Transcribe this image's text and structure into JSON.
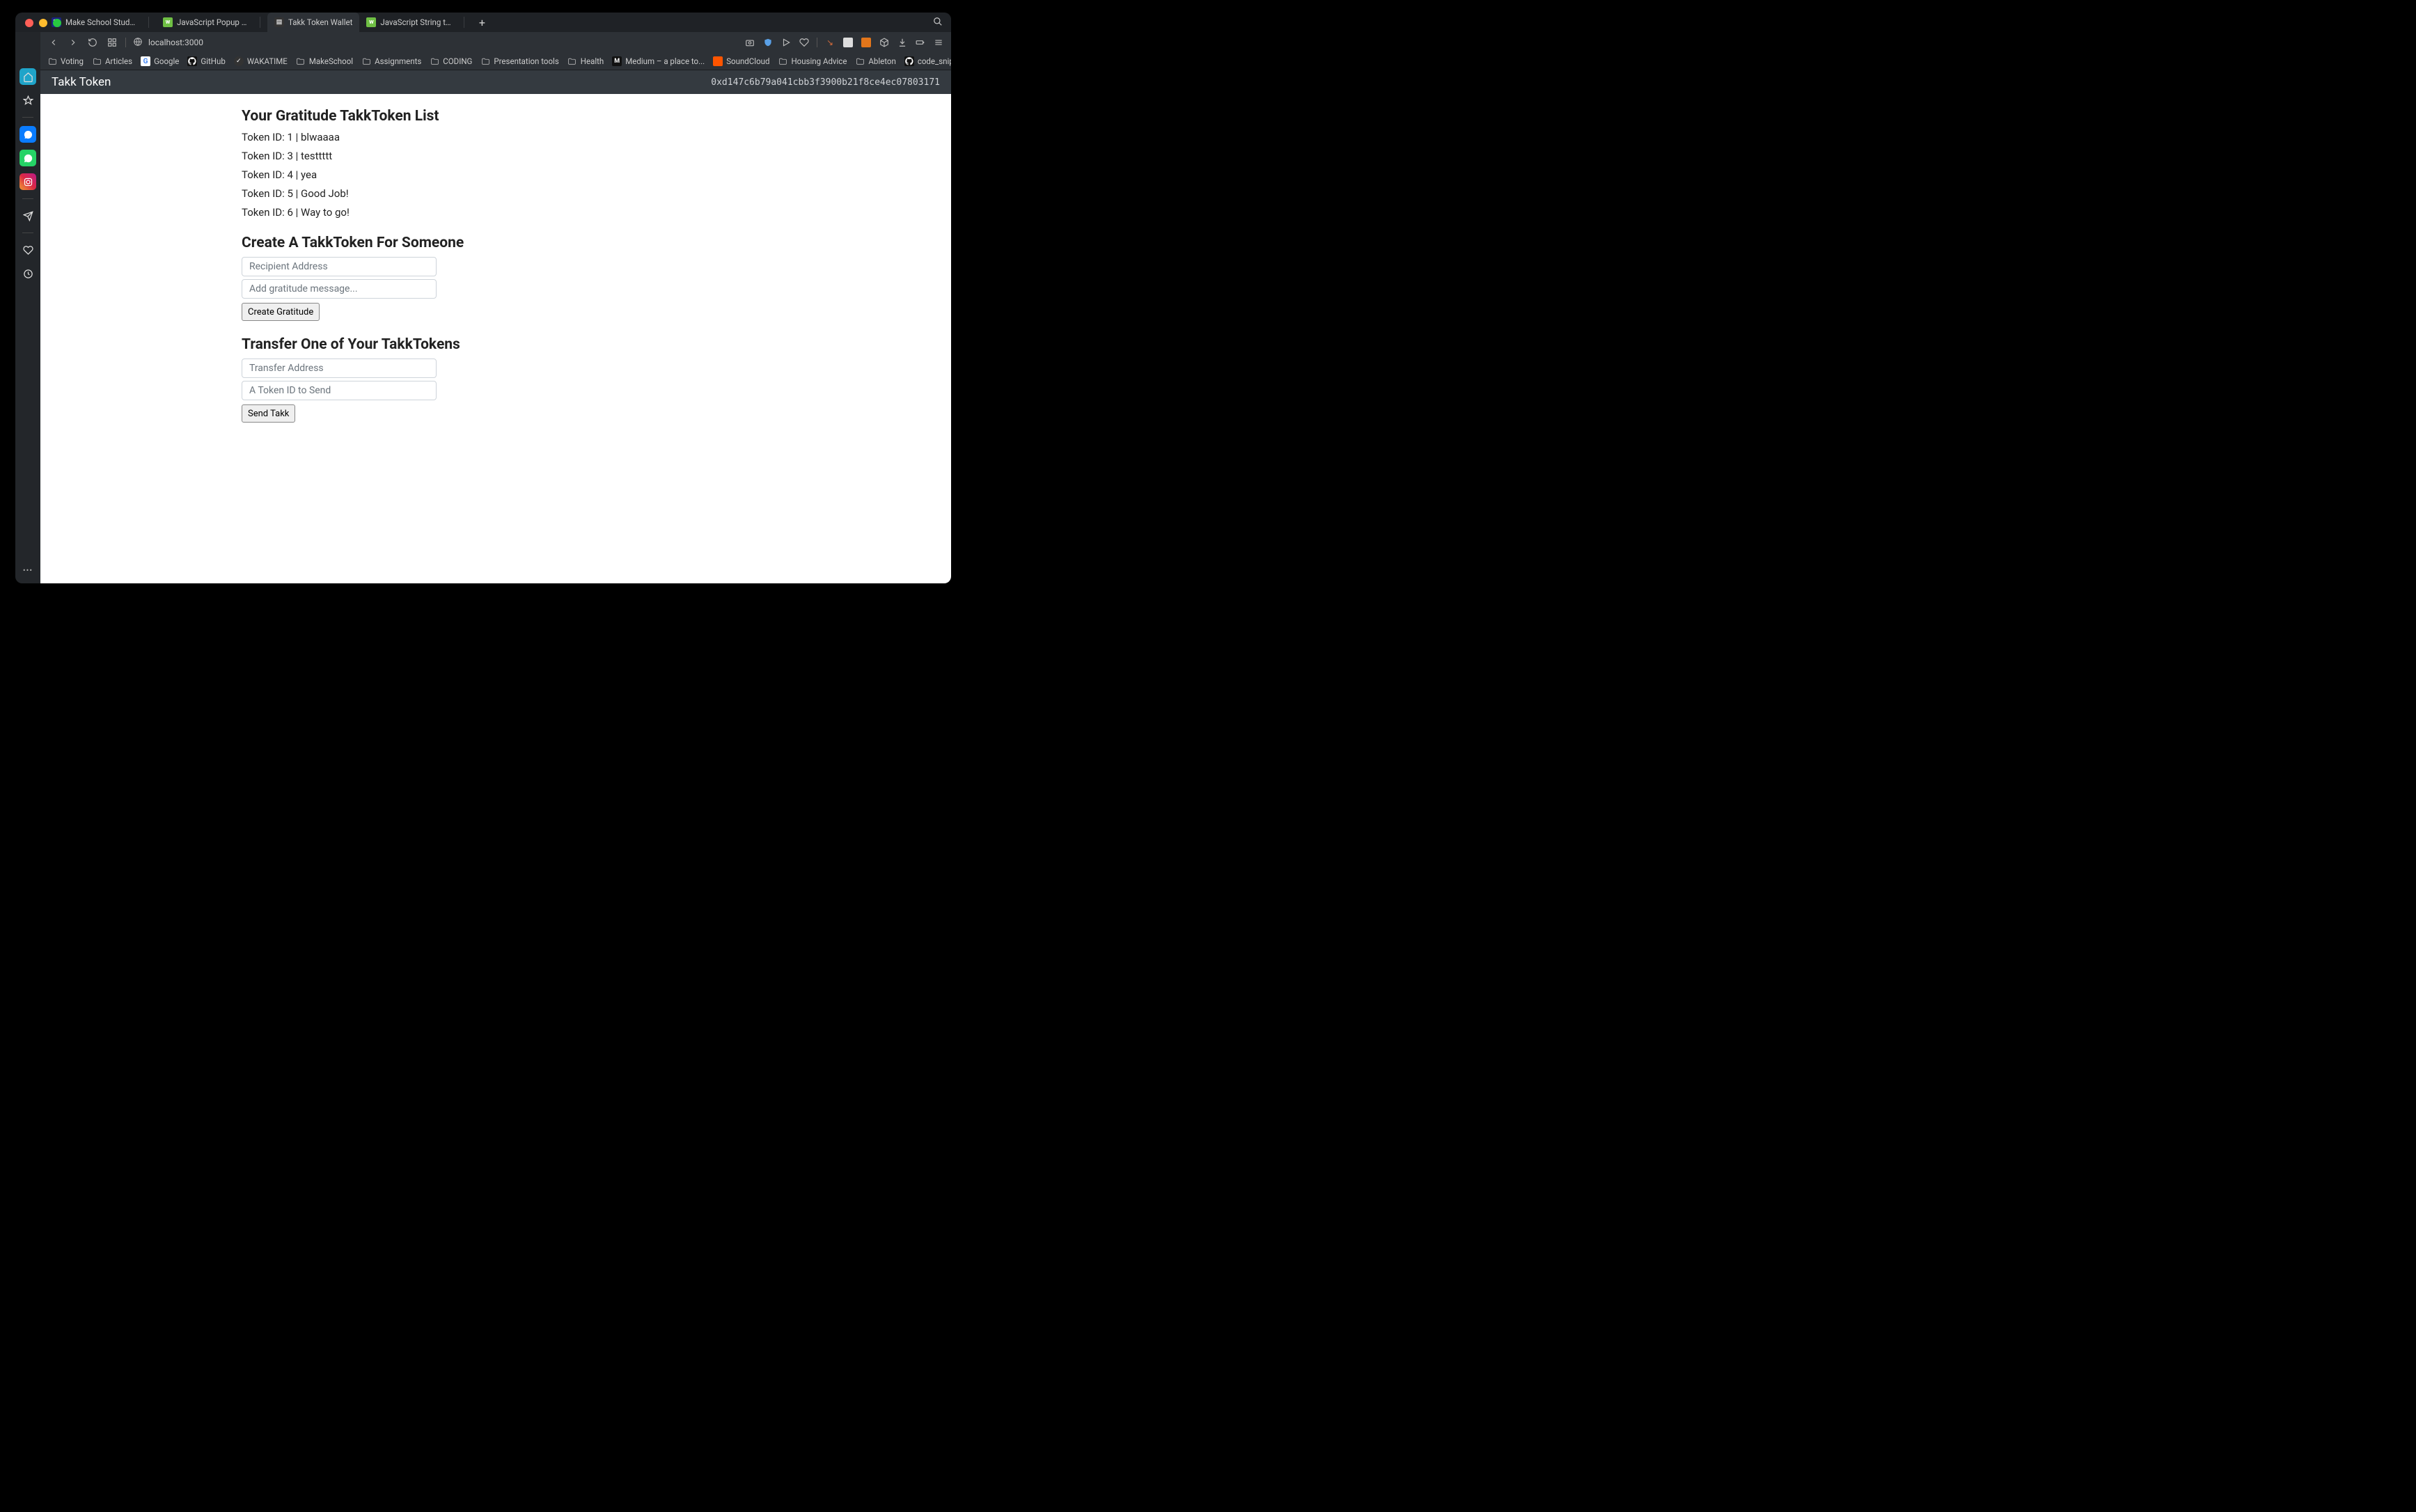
{
  "tabs": {
    "t0": "Make School Students - Calend",
    "t1": "JavaScript Popup Boxes",
    "t2": "Takk Token Wallet",
    "t3": "JavaScript String toLowerCase"
  },
  "url": "localhost:3000",
  "bookmarks": {
    "b0": "Voting",
    "b1": "Articles",
    "b2": "Google",
    "b3": "GitHub",
    "b4": "WAKATIME",
    "b5": "MakeSchool",
    "b6": "Assignments",
    "b7": "CODING",
    "b8": "Presentation tools",
    "b9": "Health",
    "b10": "Medium – a place to...",
    "b11": "SoundCloud",
    "b12": "Housing Advice",
    "b13": "Ableton",
    "b14": "code_snippets/Djan..."
  },
  "page": {
    "brand": "Takk Token",
    "address": "0xd147c6b79a041cbb3f3900b21f8ce4ec07803171",
    "listTitle": "Your Gratitude TakkToken List",
    "tokens": {
      "r0": "Token ID: 1 | blwaaaa",
      "r1": "Token ID: 3 | testtttt",
      "r2": "Token ID: 4 | yea",
      "r3": "Token ID: 5 | Good Job!",
      "r4": "Token ID: 6 | Way to go!"
    },
    "createTitle": "Create A TakkToken For Someone",
    "createForm": {
      "recipientPlaceholder": "Recipient Address",
      "messagePlaceholder": "Add gratitude message...",
      "button": "Create Gratitude"
    },
    "transferTitle": "Transfer One of Your TakkTokens",
    "transferForm": {
      "addressPlaceholder": "Transfer Address",
      "tokenIdPlaceholder": "A Token ID to Send",
      "button": "Send Takk"
    }
  }
}
